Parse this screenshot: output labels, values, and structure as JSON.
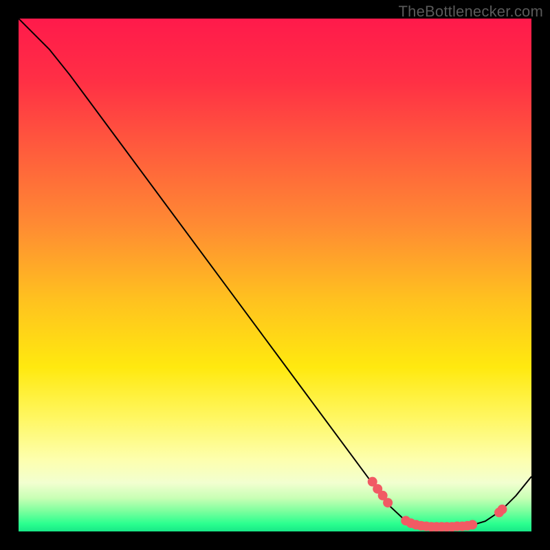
{
  "watermark": "TheBottlenecker.com",
  "chart_data": {
    "type": "line",
    "title": "",
    "xlabel": "",
    "ylabel": "",
    "xlim": [
      0,
      100
    ],
    "ylim": [
      0,
      100
    ],
    "curve": [
      {
        "x": 0,
        "y": 100
      },
      {
        "x": 6,
        "y": 94
      },
      {
        "x": 10,
        "y": 89
      },
      {
        "x": 20,
        "y": 75.5
      },
      {
        "x": 30,
        "y": 62
      },
      {
        "x": 40,
        "y": 48.5
      },
      {
        "x": 50,
        "y": 35
      },
      {
        "x": 60,
        "y": 21.5
      },
      {
        "x": 68,
        "y": 10.7
      },
      {
        "x": 72,
        "y": 5.3
      },
      {
        "x": 75,
        "y": 2.5
      },
      {
        "x": 78,
        "y": 1.2
      },
      {
        "x": 80,
        "y": 0.9
      },
      {
        "x": 84,
        "y": 0.9
      },
      {
        "x": 88,
        "y": 1.1
      },
      {
        "x": 91,
        "y": 2.0
      },
      {
        "x": 94,
        "y": 4.0
      },
      {
        "x": 97,
        "y": 7.0
      },
      {
        "x": 100,
        "y": 10.7
      }
    ],
    "markers": [
      {
        "x": 69.0,
        "y": 9.7
      },
      {
        "x": 70.0,
        "y": 8.3
      },
      {
        "x": 71.0,
        "y": 7.0
      },
      {
        "x": 72.0,
        "y": 5.6
      },
      {
        "x": 75.5,
        "y": 2.1
      },
      {
        "x": 76.5,
        "y": 1.6
      },
      {
        "x": 77.5,
        "y": 1.3
      },
      {
        "x": 78.5,
        "y": 1.1
      },
      {
        "x": 79.5,
        "y": 1.0
      },
      {
        "x": 80.5,
        "y": 0.9
      },
      {
        "x": 81.5,
        "y": 0.9
      },
      {
        "x": 82.5,
        "y": 0.9
      },
      {
        "x": 83.5,
        "y": 0.9
      },
      {
        "x": 84.5,
        "y": 0.9
      },
      {
        "x": 85.5,
        "y": 1.0
      },
      {
        "x": 86.5,
        "y": 1.0
      },
      {
        "x": 87.5,
        "y": 1.1
      },
      {
        "x": 88.5,
        "y": 1.3
      },
      {
        "x": 93.7,
        "y": 3.7
      },
      {
        "x": 94.3,
        "y": 4.3
      }
    ],
    "gradient_stops": [
      {
        "offset": 0.0,
        "color": "#ff1a4b"
      },
      {
        "offset": 0.12,
        "color": "#ff2f45"
      },
      {
        "offset": 0.25,
        "color": "#ff5a3d"
      },
      {
        "offset": 0.4,
        "color": "#ff8a33"
      },
      {
        "offset": 0.55,
        "color": "#ffc21f"
      },
      {
        "offset": 0.68,
        "color": "#ffe90f"
      },
      {
        "offset": 0.78,
        "color": "#fff763"
      },
      {
        "offset": 0.86,
        "color": "#fdffae"
      },
      {
        "offset": 0.905,
        "color": "#f2ffd0"
      },
      {
        "offset": 0.935,
        "color": "#c8ffb5"
      },
      {
        "offset": 0.96,
        "color": "#7dff9e"
      },
      {
        "offset": 0.985,
        "color": "#2bff8f"
      },
      {
        "offset": 1.0,
        "color": "#18e887"
      }
    ],
    "line_color": "#000000",
    "marker_color": "#f15a64",
    "marker_radius_px": 7
  }
}
